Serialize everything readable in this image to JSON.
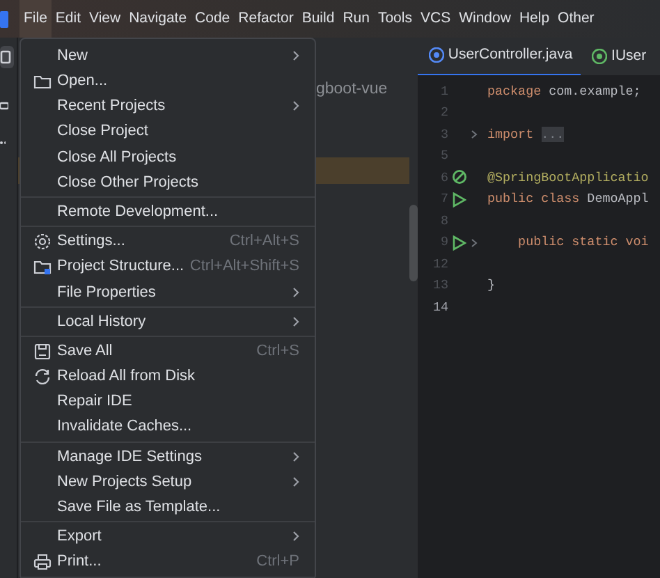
{
  "menubar": [
    {
      "label": "File",
      "selected": true
    },
    {
      "label": "Edit",
      "selected": false
    },
    {
      "label": "View",
      "selected": false
    },
    {
      "label": "Navigate",
      "selected": false
    },
    {
      "label": "Code",
      "selected": false
    },
    {
      "label": "Refactor",
      "selected": false
    },
    {
      "label": "Build",
      "selected": false
    },
    {
      "label": "Run",
      "selected": false
    },
    {
      "label": "Tools",
      "selected": false
    },
    {
      "label": "VCS",
      "selected": false
    },
    {
      "label": "Window",
      "selected": false
    },
    {
      "label": "Help",
      "selected": false
    },
    {
      "label": "Other",
      "selected": false
    }
  ],
  "project_panel": {
    "rows": [
      {
        "label": "gboot-vue",
        "selected": false
      },
      {
        "selected": true
      }
    ]
  },
  "tabs": [
    {
      "label": "UserController.java",
      "kind": "class",
      "selected": true
    },
    {
      "label": "IUser",
      "kind": "interface",
      "selected": false
    }
  ],
  "editor": {
    "lines": [
      {
        "number": "1",
        "kind": "code",
        "tokens": [
          {
            "text": "package",
            "kind": "keyword"
          },
          {
            "text": " com.example;",
            "kind": "plain"
          }
        ]
      },
      {
        "number": "2",
        "kind": "code"
      },
      {
        "number": "3",
        "kind": "code",
        "fold": true,
        "tokens": [
          {
            "text": "import",
            "kind": "keyword"
          },
          {
            "text": "...",
            "kind": "folded"
          }
        ]
      },
      {
        "number": "5",
        "kind": "code"
      },
      {
        "number": "6",
        "kind": "bean",
        "tokens": [
          {
            "text": "@SpringBootApplicatio",
            "kind": "annotation"
          }
        ]
      },
      {
        "number": "7",
        "kind": "run",
        "tokens": [
          {
            "text": "public class",
            "kind": "keyword"
          },
          {
            "text": " DemoAppl",
            "kind": "plain"
          }
        ]
      },
      {
        "number": "8",
        "kind": "code"
      },
      {
        "number": "9",
        "kind": "run",
        "fold": true,
        "tokens": [
          {
            "text": "    public static voi",
            "kind": "keyword"
          }
        ]
      },
      {
        "number": "12",
        "kind": "code"
      },
      {
        "number": "13",
        "kind": "code",
        "tokens": [
          {
            "text": "}",
            "kind": "plain"
          }
        ]
      },
      {
        "number": "14",
        "kind": "code",
        "current": true
      }
    ]
  },
  "file_menu": [
    {
      "kind": "item",
      "label": "New",
      "submenu": true
    },
    {
      "kind": "folder",
      "label": "Open..."
    },
    {
      "kind": "item",
      "label": "Recent Projects",
      "submenu": true
    },
    {
      "kind": "item",
      "label": "Close Project"
    },
    {
      "kind": "item",
      "label": "Close All Projects"
    },
    {
      "kind": "item",
      "label": "Close Other Projects"
    },
    {
      "kind": "separator"
    },
    {
      "kind": "item",
      "label": "Remote Development..."
    },
    {
      "kind": "separator"
    },
    {
      "kind": "gear",
      "label": "Settings...",
      "shortcut": "Ctrl+Alt+S"
    },
    {
      "kind": "structure",
      "label": "Project Structure...",
      "shortcut": "Ctrl+Alt+Shift+S"
    },
    {
      "kind": "item",
      "label": "File Properties",
      "submenu": true
    },
    {
      "kind": "separator"
    },
    {
      "kind": "item",
      "label": "Local History",
      "submenu": true
    },
    {
      "kind": "separator"
    },
    {
      "kind": "disk",
      "label": "Save All",
      "shortcut": "Ctrl+S"
    },
    {
      "kind": "reload",
      "label": "Reload All from Disk"
    },
    {
      "kind": "item",
      "label": "Repair IDE"
    },
    {
      "kind": "item",
      "label": "Invalidate Caches..."
    },
    {
      "kind": "separator"
    },
    {
      "kind": "item",
      "label": "Manage IDE Settings",
      "submenu": true
    },
    {
      "kind": "item",
      "label": "New Projects Setup",
      "submenu": true
    },
    {
      "kind": "item",
      "label": "Save File as Template..."
    },
    {
      "kind": "separator"
    },
    {
      "kind": "item",
      "label": "Export",
      "submenu": true
    },
    {
      "kind": "printer",
      "label": "Print...",
      "shortcut": "Ctrl+P"
    },
    {
      "kind": "separator"
    }
  ]
}
